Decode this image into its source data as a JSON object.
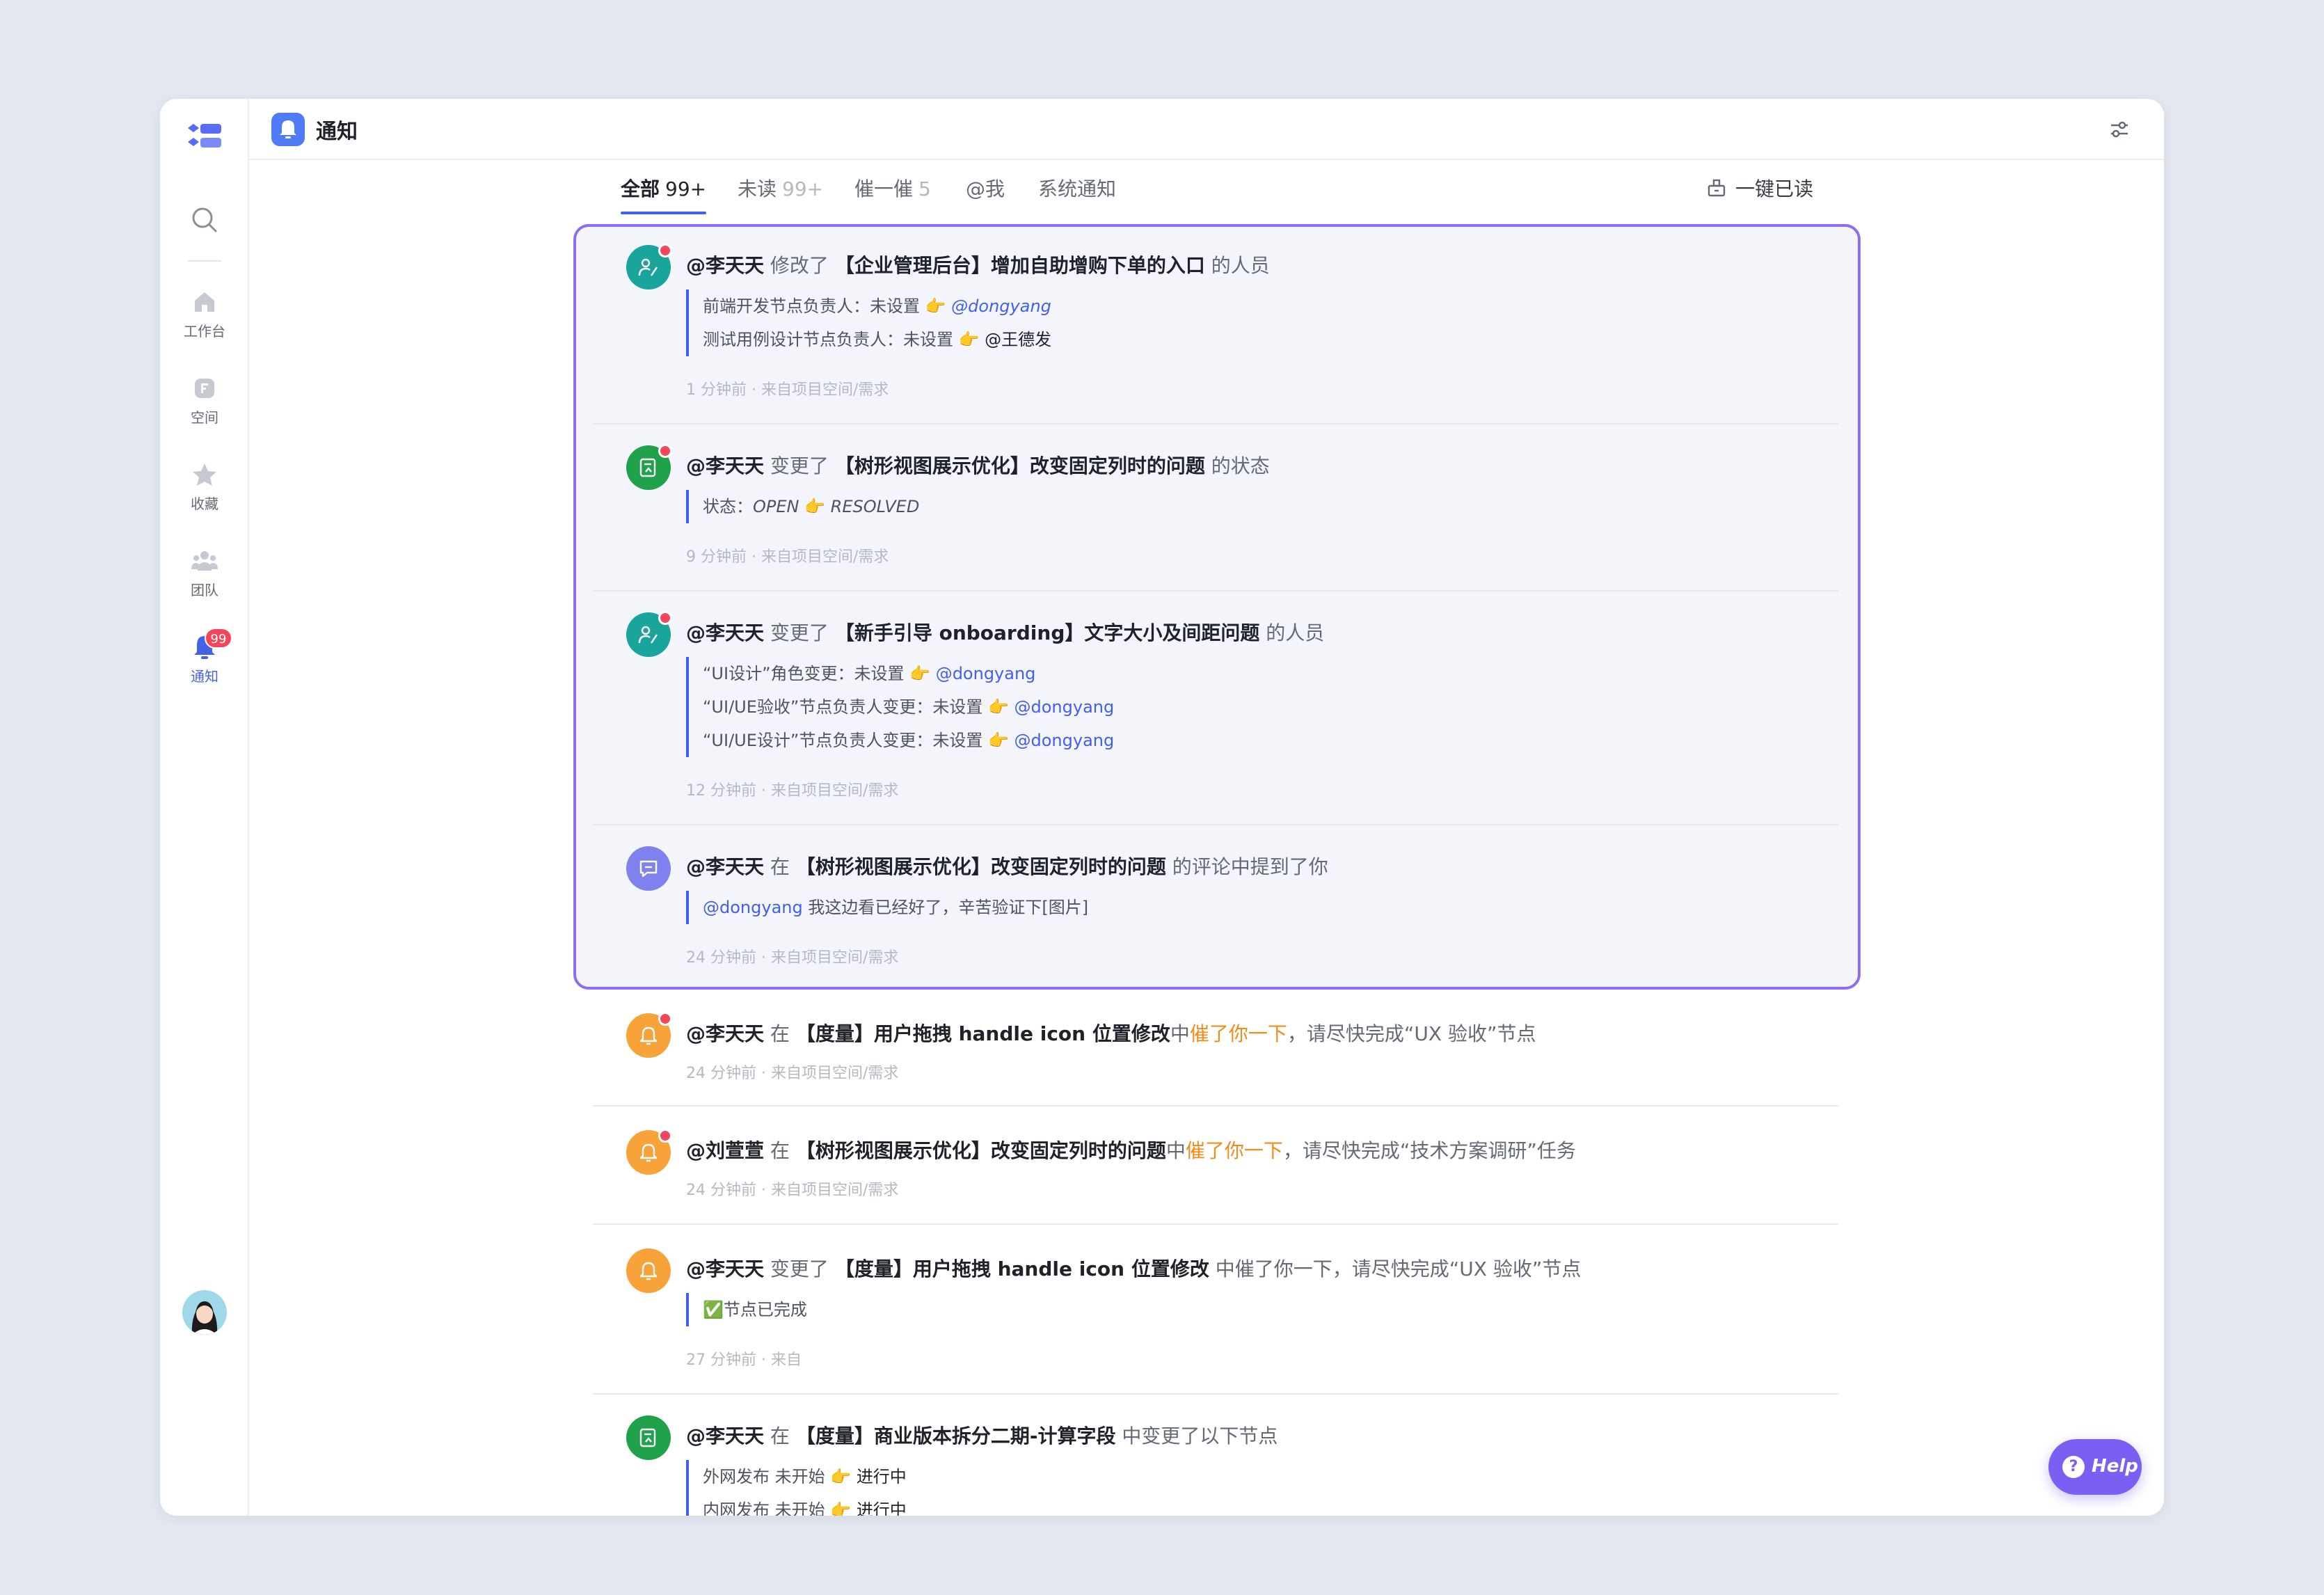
{
  "app": {
    "title": "通知"
  },
  "rail": {
    "items": [
      {
        "label": "工作台",
        "icon": "home-icon"
      },
      {
        "label": "空间",
        "icon": "space-icon"
      },
      {
        "label": "收藏",
        "icon": "star-icon"
      },
      {
        "label": "团队",
        "icon": "team-icon"
      },
      {
        "label": "通知",
        "icon": "bell-icon",
        "badge": "99"
      }
    ]
  },
  "tabs": [
    {
      "label": "全部",
      "count": "99+"
    },
    {
      "label": "未读",
      "count": "99+"
    },
    {
      "label": "催一催",
      "count": "5"
    },
    {
      "label": "@我",
      "count": ""
    },
    {
      "label": "系统通知",
      "count": ""
    }
  ],
  "mark_all_read": "一键已读",
  "notifications": [
    {
      "who": "@李天天",
      "verb": "修改了",
      "object": "【企业管理后台】增加自助增购下单的入口",
      "suffix": "的人员",
      "lines": [
        {
          "pre": "前端开发节点负责人：未设置",
          "arrow": "👉",
          "to": "@dongyang"
        },
        {
          "pre": "测试用例设计节点负责人：未设置",
          "arrow": "👉",
          "to": "@王德发"
        }
      ],
      "meta": "1 分钟前 · 来自项目空间/需求"
    },
    {
      "who": "@李天天",
      "verb": "变更了",
      "object": "【树形视图展示优化】改变固定列时的问题",
      "suffix": "的状态",
      "lines": [
        {
          "pre": "状态：",
          "from": "OPEN",
          "arrow": "👉",
          "to": "RESOLVED"
        }
      ],
      "meta": "9 分钟前 · 来自项目空间/需求"
    },
    {
      "who": "@李天天",
      "verb": "变更了",
      "object": "【新手引导 onboarding】文字大小及间距问题",
      "suffix": "的人员",
      "lines": [
        {
          "pre": "“UI设计”角色变更：未设置",
          "arrow": "👉",
          "to": "@dongyang"
        },
        {
          "pre": "“UI/UE验收”节点负责人变更：未设置",
          "arrow": "👉",
          "to": "@dongyang"
        },
        {
          "pre": "“UI/UE设计”节点负责人变更：未设置",
          "arrow": "👉",
          "to": "@dongyang"
        }
      ],
      "meta": "12 分钟前 · 来自项目空间/需求"
    },
    {
      "who": "@李天天",
      "verb": "在",
      "object": "【树形视图展示优化】改变固定列时的问题",
      "suffix": "的评论中提到了你",
      "lines": [
        {
          "mention": "@dongyang",
          "text": "我这边看已经好了，辛苦验证下[图片]"
        }
      ],
      "meta": "24 分钟前 · 来自项目空间/需求"
    },
    {
      "who": "@李天天",
      "verb": "在",
      "object": "【度量】用户拖拽 handle icon 位置修改",
      "mid": "中",
      "highlight": "催了你一下",
      "suffix": "，请尽快完成“UX 验收”节点",
      "meta": "24 分钟前 · 来自项目空间/需求"
    },
    {
      "who": "@刘萱萱",
      "verb": "在",
      "object": "【树形视图展示优化】改变固定列时的问题",
      "mid": "中",
      "highlight": "催了你一下",
      "suffix": "，请尽快完成“技术方案调研”任务",
      "meta": "24 分钟前 · 来自项目空间/需求"
    },
    {
      "who": "@李天天",
      "verb": "变更了",
      "object": "【度量】用户拖拽 handle icon 位置修改",
      "suffix": "中催了你一下，请尽快完成“UX 验收”节点",
      "lines": [
        {
          "text": "✅节点已完成"
        }
      ],
      "meta": "27 分钟前 · 来自"
    },
    {
      "who": "@李天天",
      "verb": "在",
      "object": "【度量】商业版本拆分二期-计算字段",
      "suffix": "中变更了以下节点",
      "lines": [
        {
          "pre": "外网发布  未开始",
          "arrow": "👉",
          "to": "进行中"
        },
        {
          "pre": "内网发布  未开始",
          "arrow": "👉",
          "to": "进行中"
        }
      ]
    }
  ],
  "help": {
    "label": "Help",
    "glyph": "?"
  },
  "colors": {
    "accent": "#3f5ff0",
    "highlight_border": "#8f6cf0",
    "urge": "#f08c1b",
    "badge": "#f5455a"
  }
}
